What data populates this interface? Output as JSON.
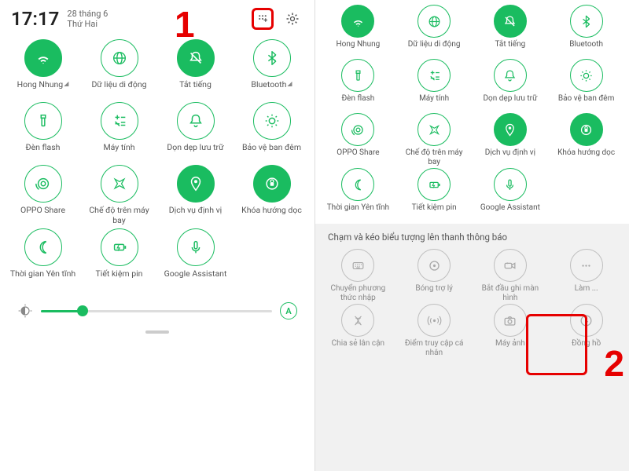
{
  "colors": {
    "accent": "#1abc60",
    "annotation": "#e60000"
  },
  "annotations": {
    "one": "1",
    "two": "2"
  },
  "left": {
    "time": "17:17",
    "date_top": "28 tháng 6",
    "date_bottom": "Thứ Hai",
    "edit_icon": "grid-edit-icon",
    "settings_icon": "gear-icon",
    "brightness": {
      "percent": 18,
      "auto": "A"
    },
    "tiles": [
      {
        "id": "wifi",
        "label": "Hong Nhung",
        "icon": "wifi",
        "active": true,
        "dropdown": true
      },
      {
        "id": "data",
        "label": "Dữ liệu di động",
        "icon": "globe",
        "active": false,
        "dropdown": false
      },
      {
        "id": "mute",
        "label": "Tắt tiếng",
        "icon": "bell-off",
        "active": true,
        "dropdown": false
      },
      {
        "id": "bluetooth",
        "label": "Bluetooth",
        "icon": "bluetooth",
        "active": false,
        "dropdown": true
      },
      {
        "id": "flash",
        "label": "Đèn flash",
        "icon": "flashlight",
        "active": false
      },
      {
        "id": "calc",
        "label": "Máy tính",
        "icon": "calc",
        "active": false
      },
      {
        "id": "clean",
        "label": "Dọn dẹp lưu trữ",
        "icon": "bell",
        "active": false
      },
      {
        "id": "night",
        "label": "Bảo vệ ban đêm",
        "icon": "sun-dots",
        "active": false
      },
      {
        "id": "opposhare",
        "label": "OPPO Share",
        "icon": "share",
        "active": false
      },
      {
        "id": "airplane",
        "label": "Chế độ trên máy bay",
        "icon": "plane",
        "active": false
      },
      {
        "id": "location",
        "label": "Dịch vụ định vị",
        "icon": "pin",
        "active": true
      },
      {
        "id": "rotlock",
        "label": "Khóa hướng dọc",
        "icon": "rot-lock",
        "active": true
      },
      {
        "id": "zen",
        "label": "Thời gian Yên tĩnh",
        "icon": "moon",
        "active": false
      },
      {
        "id": "batt",
        "label": "Tiết kiệm pin",
        "icon": "battery",
        "active": false
      },
      {
        "id": "assistant",
        "label": "Google Assistant",
        "icon": "mic",
        "active": false
      }
    ]
  },
  "right": {
    "tiles_top": [
      {
        "id": "wifi",
        "label": "Hong Nhung",
        "icon": "wifi",
        "active": true
      },
      {
        "id": "data",
        "label": "Dữ liệu di động",
        "icon": "globe",
        "active": false
      },
      {
        "id": "mute",
        "label": "Tắt tiếng",
        "icon": "bell-off",
        "active": true
      },
      {
        "id": "bluetooth",
        "label": "Bluetooth",
        "icon": "bluetooth",
        "active": false
      },
      {
        "id": "flash",
        "label": "Đèn flash",
        "icon": "flashlight",
        "active": false
      },
      {
        "id": "calc",
        "label": "Máy tính",
        "icon": "calc",
        "active": false
      },
      {
        "id": "clean",
        "label": "Dọn dẹp lưu trữ",
        "icon": "bell",
        "active": false
      },
      {
        "id": "night",
        "label": "Bảo vệ ban đêm",
        "icon": "sun-dots",
        "active": false
      },
      {
        "id": "opposhare",
        "label": "OPPO Share",
        "icon": "share",
        "active": false
      },
      {
        "id": "airplane",
        "label": "Chế độ trên máy bay",
        "icon": "plane",
        "active": false
      },
      {
        "id": "location",
        "label": "Dịch vụ định vị",
        "icon": "pin",
        "active": true
      },
      {
        "id": "rotlock",
        "label": "Khóa hướng dọc",
        "icon": "rot-lock",
        "active": true
      },
      {
        "id": "zen",
        "label": "Thời gian Yên tĩnh",
        "icon": "moon",
        "active": false
      },
      {
        "id": "batt",
        "label": "Tiết kiệm pin",
        "icon": "battery",
        "active": false
      },
      {
        "id": "assistant",
        "label": "Google Assistant",
        "icon": "mic",
        "active": false
      },
      {
        "id": "blank",
        "label": "",
        "icon": "",
        "active": false,
        "hidden": true
      }
    ],
    "drag_hint": "Chạm và kéo biểu tượng lên thanh thông báo",
    "tiles_drag": [
      {
        "id": "ime",
        "label": "Chuyển phương thức nhập",
        "icon": "keyboard"
      },
      {
        "id": "ball",
        "label": "Bóng trợ lý",
        "icon": "circle-dot"
      },
      {
        "id": "record",
        "label": "Bắt đầu ghi màn hình",
        "icon": "video"
      },
      {
        "id": "hidden1",
        "label": "Làm ...",
        "icon": "dots"
      },
      {
        "id": "nearby",
        "label": "Chia sẻ lân cận",
        "icon": "dna"
      },
      {
        "id": "hotspot",
        "label": "Điểm truy cập cá nhân",
        "icon": "hotspot"
      },
      {
        "id": "camera",
        "label": "Máy ảnh",
        "icon": "camera"
      },
      {
        "id": "clock",
        "label": "Đồng hồ",
        "icon": "clock"
      }
    ]
  }
}
